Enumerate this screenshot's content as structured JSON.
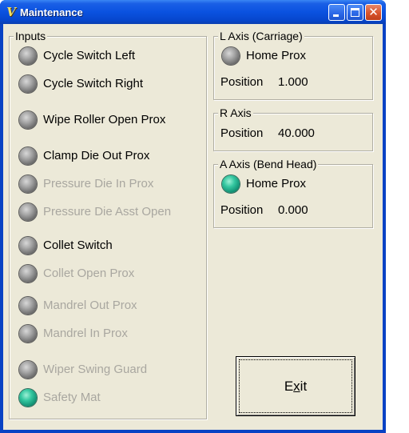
{
  "window": {
    "title": "Maintenance",
    "app_icon_text": "V"
  },
  "inputs": {
    "title": "Inputs",
    "items": [
      {
        "label": "Cycle Switch Left",
        "state": "off",
        "enabled": true
      },
      {
        "label": "Cycle Switch Right",
        "state": "off",
        "enabled": true
      },
      {
        "label": "Wipe Roller Open Prox",
        "state": "off",
        "enabled": true
      },
      {
        "label": "Clamp Die Out Prox",
        "state": "off",
        "enabled": true
      },
      {
        "label": "Pressure Die In Prox",
        "state": "off",
        "enabled": false
      },
      {
        "label": "Pressure Die Asst Open",
        "state": "off",
        "enabled": false
      },
      {
        "label": "Collet Switch",
        "state": "off",
        "enabled": true
      },
      {
        "label": "Collet Open Prox",
        "state": "off",
        "enabled": false
      },
      {
        "label": "Mandrel Out Prox",
        "state": "off",
        "enabled": false
      },
      {
        "label": "Mandrel In Prox",
        "state": "off",
        "enabled": false
      },
      {
        "label": "Wiper Swing Guard",
        "state": "off",
        "enabled": false
      },
      {
        "label": "Safety Mat",
        "state": "on",
        "enabled": false
      }
    ]
  },
  "l_axis": {
    "title": "L Axis (Carriage)",
    "home_label": "Home Prox",
    "home_state": "off",
    "position_label": "Position",
    "position_value": "1.000"
  },
  "r_axis": {
    "title": "R Axis",
    "position_label": "Position",
    "position_value": "40.000"
  },
  "a_axis": {
    "title": "A Axis (Bend Head)",
    "home_label": "Home Prox",
    "home_state": "on",
    "position_label": "Position",
    "position_value": "0.000"
  },
  "exit_button": {
    "label_pre": "E",
    "label_mnemonic": "x",
    "label_post": "it"
  },
  "colors": {
    "titlebar": "#0a52e0",
    "client_bg": "#ece9d8",
    "led_on": "#34c7a0",
    "led_off": "#7a7a7a",
    "disabled_text": "#a9a7a0"
  }
}
